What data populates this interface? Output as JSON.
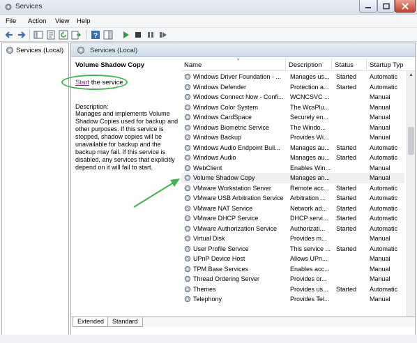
{
  "window": {
    "title": "Services"
  },
  "menubar": [
    "File",
    "Action",
    "View",
    "Help"
  ],
  "tree": {
    "item": "Services (Local)"
  },
  "content": {
    "header": "Services (Local)"
  },
  "detail": {
    "service_name": "Volume Shadow Copy",
    "start_link": "Start",
    "start_suffix": " the service",
    "description_label": "Description:",
    "description": "Manages and implements Volume Shadow Copies used for backup and other purposes. If this service is stopped, shadow copies will be unavailable for backup and the backup may fail. If this service is disabled, any services that explicitly depend on it will fail to start."
  },
  "columns": [
    "Name",
    "Description",
    "Status",
    "Startup Typ"
  ],
  "services": [
    {
      "name": "Windows Driver Foundation - ...",
      "description": "Manages us...",
      "status": "Started",
      "startup": "Automatic"
    },
    {
      "name": "Windows Defender",
      "description": "Protection a...",
      "status": "Started",
      "startup": "Automatic"
    },
    {
      "name": "Windows Connect Now - Confi...",
      "description": "WCNCSVC ...",
      "status": "",
      "startup": "Manual"
    },
    {
      "name": "Windows Color System",
      "description": "The WcsPlu...",
      "status": "",
      "startup": "Manual"
    },
    {
      "name": "Windows CardSpace",
      "description": "Securely en...",
      "status": "",
      "startup": "Manual"
    },
    {
      "name": "Windows Biometric Service",
      "description": "The Windo...",
      "status": "",
      "startup": "Manual"
    },
    {
      "name": "Windows Backup",
      "description": "Provides Wi...",
      "status": "",
      "startup": "Manual"
    },
    {
      "name": "Windows Audio Endpoint Buil...",
      "description": "Manages au...",
      "status": "Started",
      "startup": "Automatic"
    },
    {
      "name": "Windows Audio",
      "description": "Manages au...",
      "status": "Started",
      "startup": "Automatic"
    },
    {
      "name": "WebClient",
      "description": "Enables Win...",
      "status": "",
      "startup": "Manual"
    },
    {
      "name": "Volume Shadow Copy",
      "description": "Manages an...",
      "status": "",
      "startup": "Manual",
      "selected": true
    },
    {
      "name": "VMware Workstation Server",
      "description": "Remote acc...",
      "status": "Started",
      "startup": "Automatic"
    },
    {
      "name": "VMware USB Arbitration Service",
      "description": "Arbitration ...",
      "status": "Started",
      "startup": "Automatic"
    },
    {
      "name": "VMware NAT Service",
      "description": "Network ad...",
      "status": "Started",
      "startup": "Automatic"
    },
    {
      "name": "VMware DHCP Service",
      "description": "DHCP servi...",
      "status": "Started",
      "startup": "Automatic"
    },
    {
      "name": "VMware Authorization Service",
      "description": "Authorizati...",
      "status": "Started",
      "startup": "Automatic"
    },
    {
      "name": "Virtual Disk",
      "description": "Provides m...",
      "status": "",
      "startup": "Manual"
    },
    {
      "name": "User Profile Service",
      "description": "This service ...",
      "status": "Started",
      "startup": "Automatic"
    },
    {
      "name": "UPnP Device Host",
      "description": "Allows UPn...",
      "status": "",
      "startup": "Manual"
    },
    {
      "name": "TPM Base Services",
      "description": "Enables acc...",
      "status": "",
      "startup": "Manual"
    },
    {
      "name": "Thread Ordering Server",
      "description": "Provides or...",
      "status": "",
      "startup": "Manual"
    },
    {
      "name": "Themes",
      "description": "Provides us...",
      "status": "Started",
      "startup": "Automatic"
    },
    {
      "name": "Telephony",
      "description": "Provides Tel...",
      "status": "",
      "startup": "Manual"
    }
  ],
  "tabs": [
    "Extended",
    "Standard"
  ],
  "colors": {
    "annotation": "#3cb54a",
    "selected_row": "#eef0f3",
    "link": "#7a2a7a"
  }
}
